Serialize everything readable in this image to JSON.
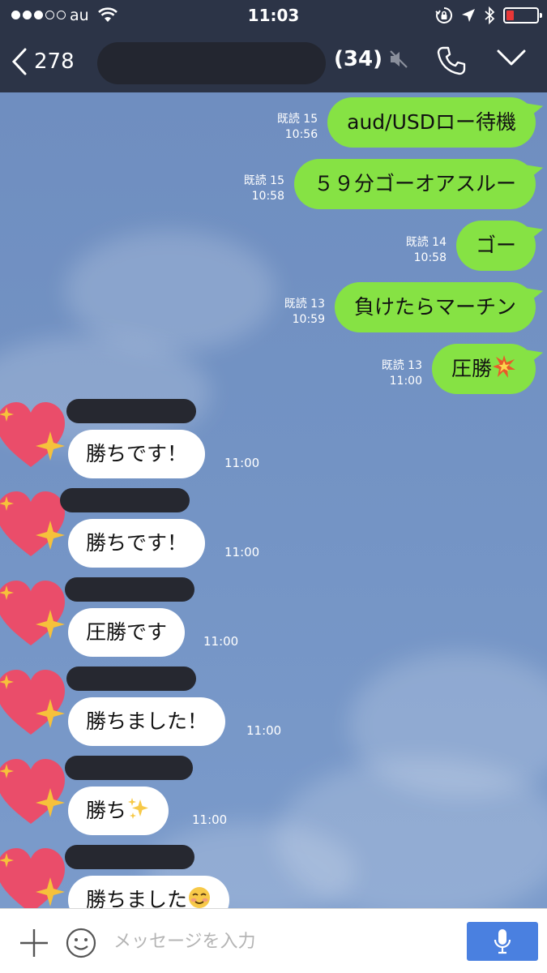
{
  "status_bar": {
    "carrier": "au",
    "time": "11:03",
    "battery_color": "#e83737"
  },
  "header": {
    "back_count": "278",
    "member_count": "(34)",
    "background_color": "#2c3447"
  },
  "outgoing_messages": [
    {
      "text": "aud/USDロー待機",
      "read": "既読 15",
      "time": "10:56"
    },
    {
      "text": "５９分ゴーオアスルー",
      "read": "既読 15",
      "time": "10:58"
    },
    {
      "text": "ゴー",
      "read": "既読 14",
      "time": "10:58"
    },
    {
      "text": "負けたらマーチン",
      "read": "既読 13",
      "time": "10:59"
    },
    {
      "text": "圧勝",
      "emoji": "collision-emoji",
      "read": "既読 13",
      "time": "11:00"
    }
  ],
  "incoming_messages": [
    {
      "text": "勝ちです！",
      "time": "11:00"
    },
    {
      "text": "勝ちです！",
      "time": "11:00"
    },
    {
      "text": "圧勝です",
      "time": "11:00"
    },
    {
      "text": "勝ちました！",
      "time": "11:00"
    },
    {
      "text": "勝ち",
      "emoji": "sparkles-emoji",
      "time": "11:00"
    },
    {
      "text": "勝ちました",
      "emoji": "smiling-face-emoji"
    }
  ],
  "input": {
    "placeholder": "メッセージを入力",
    "mic_button_color": "#4a80e0"
  },
  "colors": {
    "outgoing_bubble": "#86e244",
    "incoming_bubble": "#ffffff",
    "chat_background": "#7393c4"
  }
}
